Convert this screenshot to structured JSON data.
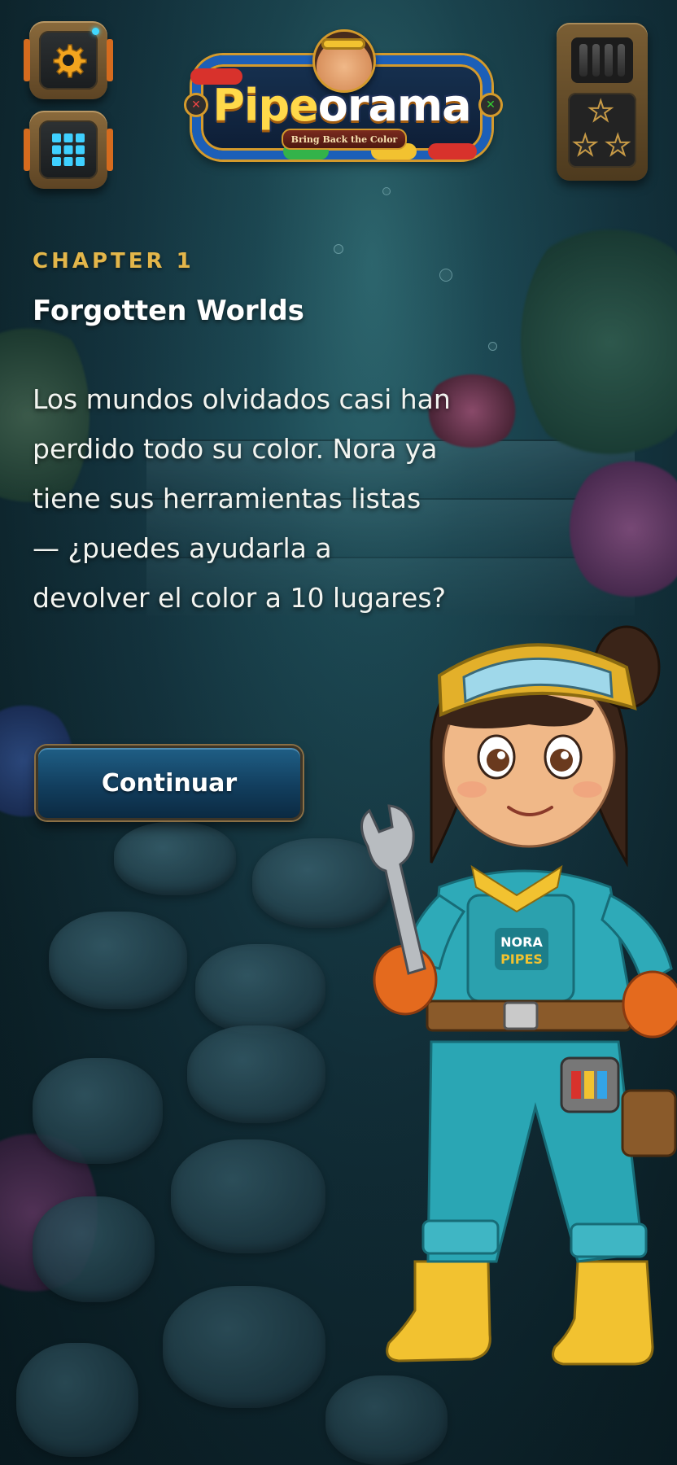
{
  "logo": {
    "title_part1": "Pipe",
    "title_part2": "orama",
    "subtitle": "Bring Back the Color"
  },
  "chapter": {
    "label": "CHAPTER 1",
    "title": "Forgotten Worlds",
    "story": "Los mundos olvidados casi han perdido todo su color. Nora ya tiene sus herramientas listas — ¿puedes ayudarla a devolver el color a 10 lugares?"
  },
  "buttons": {
    "continue_label": "Continuar"
  },
  "character": {
    "name": "Nora",
    "bib_line1": "NORA",
    "bib_line2": "PIPES"
  },
  "icons": {
    "settings": "gear-icon",
    "levels": "grid-icon",
    "stars": "star-icon"
  },
  "stars": {
    "earned": 0,
    "total": 3
  },
  "colors": {
    "accent_gold": "#e3b64a",
    "button_blue": "#1f5f86",
    "frame_bronze": "#8a6a3c"
  }
}
